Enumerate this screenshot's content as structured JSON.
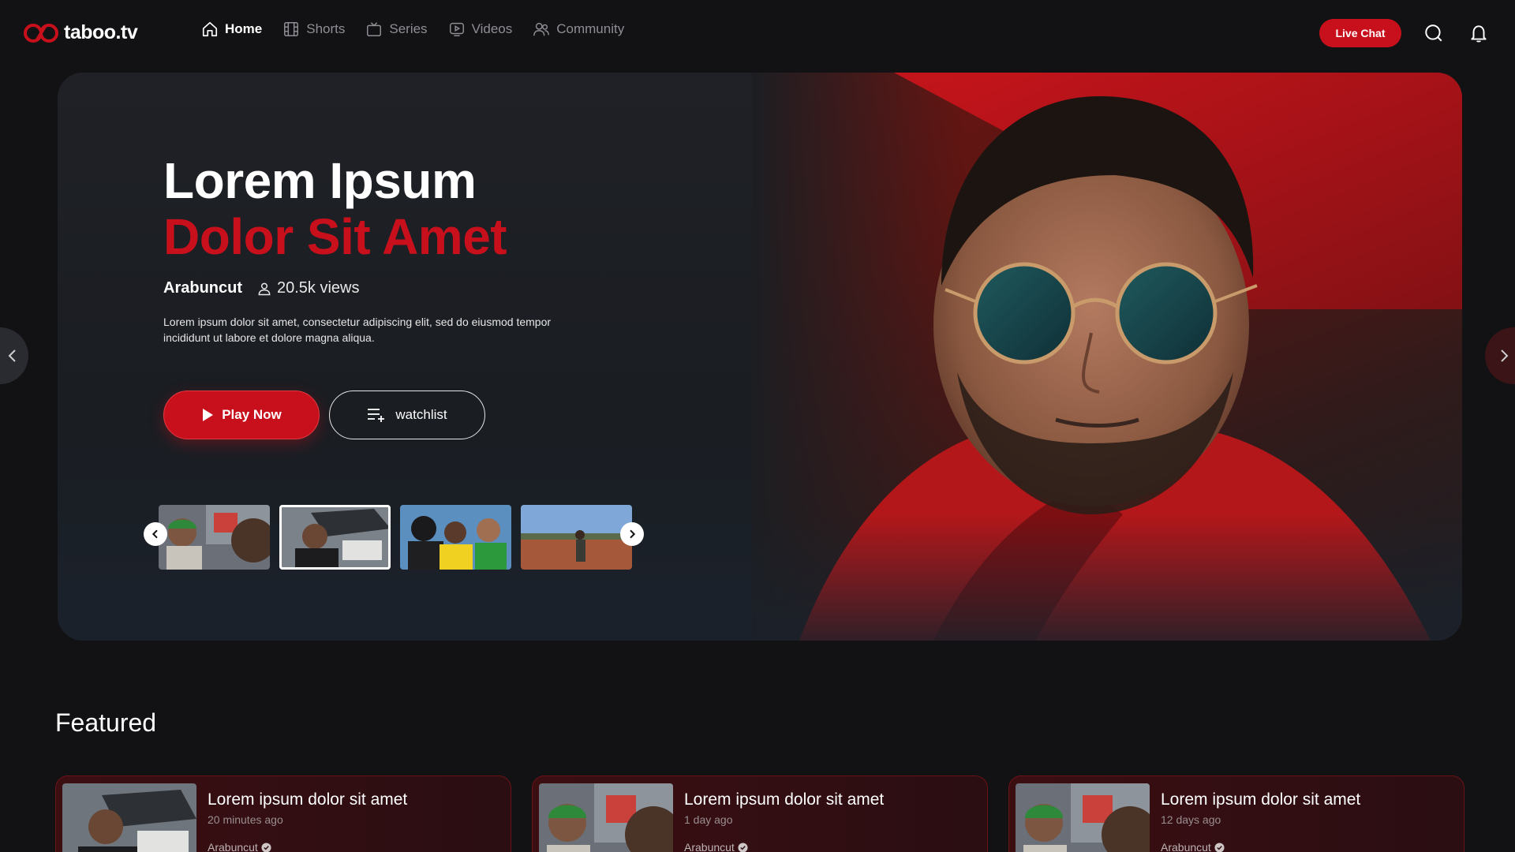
{
  "brand": {
    "name": "taboo.tv",
    "accent": "#c8101c"
  },
  "nav": {
    "items": [
      {
        "label": "Home",
        "icon": "home-icon",
        "active": true
      },
      {
        "label": "Shorts",
        "icon": "film-icon",
        "active": false
      },
      {
        "label": "Series",
        "icon": "tv-icon",
        "active": false
      },
      {
        "label": "Videos",
        "icon": "video-icon",
        "active": false
      },
      {
        "label": "Community",
        "icon": "users-icon",
        "active": false
      }
    ],
    "live_chat_label": "Live Chat"
  },
  "hero": {
    "title_line1": "Lorem Ipsum",
    "title_line2": "Dolor Sit Amet",
    "author": "Arabuncut",
    "views": "20.5k views",
    "description": "Lorem ipsum dolor sit amet, consectetur adipiscing elit, sed do eiusmod tempor incididunt ut labore et dolore magna aliqua.",
    "play_label": "Play Now",
    "watchlist_label": "watchlist",
    "selected_thumb": 1
  },
  "featured": {
    "title": "Featured",
    "cards": [
      {
        "title": "Lorem ipsum dolor sit amet",
        "time": "20 minutes ago",
        "author": "Arabuncut"
      },
      {
        "title": "Lorem ipsum dolor sit amet",
        "time": "1 day ago",
        "author": "Arabuncut"
      },
      {
        "title": "Lorem ipsum dolor sit amet",
        "time": "12 days ago",
        "author": "Arabuncut"
      }
    ]
  }
}
